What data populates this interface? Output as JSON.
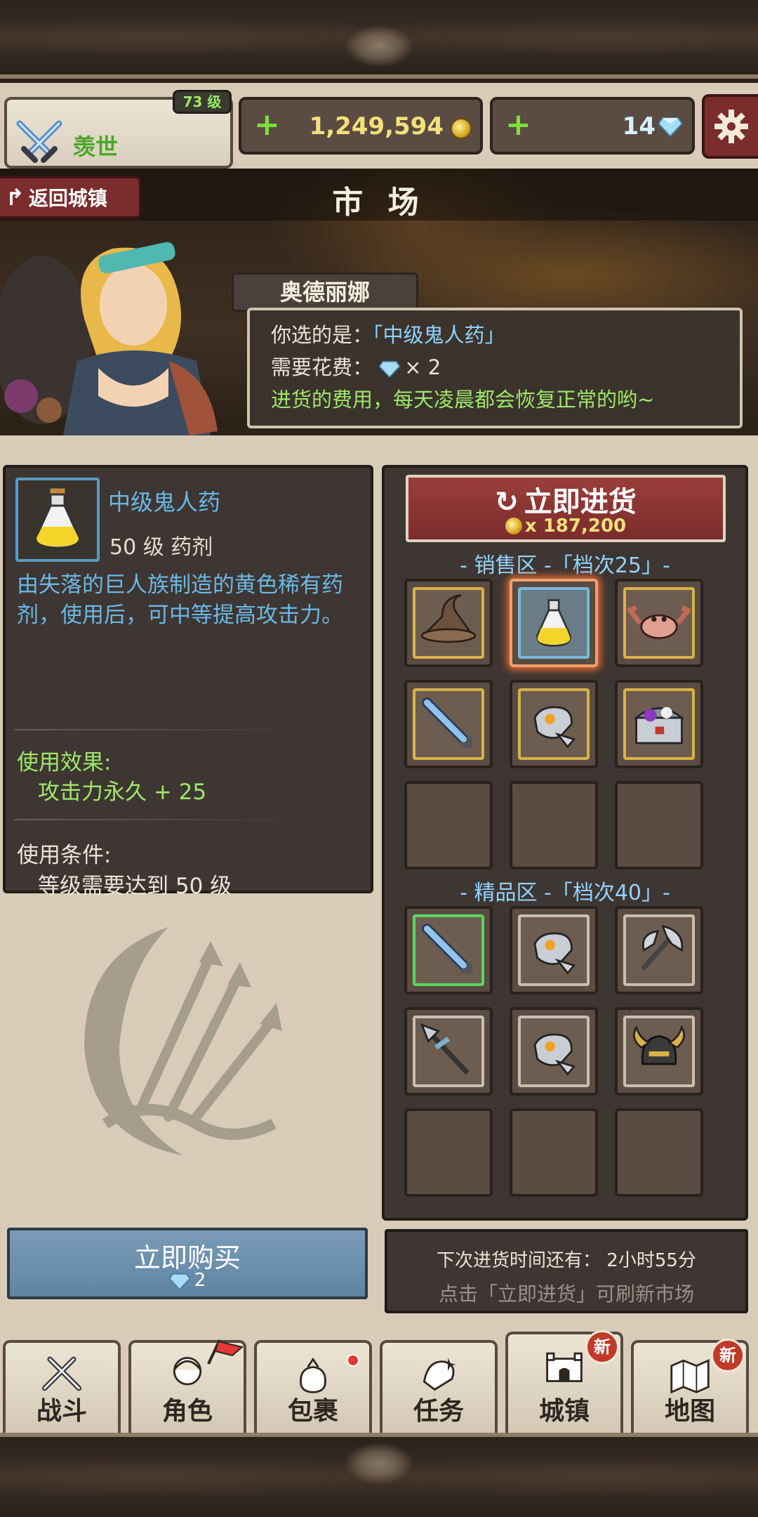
{
  "player": {
    "name": "羡世",
    "level": "73 级"
  },
  "resources": {
    "gold": "1,249,594",
    "gems": "14"
  },
  "colors": {
    "accent_red": "#7b2c2c",
    "gold_text": "#f3e07a",
    "item_blue": "#6ab8e6",
    "effect_green": "#9ee86a"
  },
  "icons": {
    "player": "crossed-swords-icon",
    "add": "plus-icon",
    "gold": "coin-icon",
    "gem": "diamond-icon",
    "settings": "gear-icon",
    "back": "return-arrow-icon",
    "refresh": "refresh-icon"
  },
  "scene": {
    "title": "市 场",
    "back_label": "返回城镇",
    "npc_name": "奥德丽娜",
    "dialog": {
      "selected_label": "你选的是：",
      "selected_item": "「中级鬼人药」",
      "cost_label": "需要花费：",
      "cost_value": "× 2",
      "note": "进货的费用，每天凌晨都会恢复正常的哟~"
    }
  },
  "item": {
    "name": "中级鬼人药",
    "type": "50 级 药剂",
    "description": "由失落的巨人族制造的黄色稀有药剂，使用后，可中等提高攻击力。",
    "effect_title": "使用效果:",
    "effect_value": "攻击力永久 + 25",
    "condition_title": "使用条件:",
    "condition_value": "等级需要达到 50 级"
  },
  "buy": {
    "label": "立即购买",
    "cost": "2"
  },
  "shop": {
    "restock_label": "立即进货",
    "restock_cost": "x 187,200",
    "sale_zone_title": "- 销售区 -「档次25」-",
    "sale_items": [
      {
        "icon": "witch-hat-icon",
        "frame": "gold"
      },
      {
        "icon": "yellow-potion-icon",
        "frame": "blue",
        "selected": true
      },
      {
        "icon": "crab-icon",
        "frame": "gold"
      },
      {
        "icon": "blue-sword-icon",
        "frame": "gold"
      },
      {
        "icon": "gauntlet-icon",
        "frame": "gold"
      },
      {
        "icon": "treasure-chest-icon",
        "frame": "gold"
      },
      {
        "icon": "",
        "frame": "empty"
      },
      {
        "icon": "",
        "frame": "empty"
      },
      {
        "icon": "",
        "frame": "empty"
      }
    ],
    "premium_zone_title": "- 精品区 -「档次40」-",
    "premium_items": [
      {
        "icon": "blue-sword-icon",
        "frame": "green"
      },
      {
        "icon": "gauntlet-icon",
        "frame": "plain"
      },
      {
        "icon": "battle-axe-icon",
        "frame": "plain"
      },
      {
        "icon": "spear-icon",
        "frame": "plain"
      },
      {
        "icon": "gauntlet-icon",
        "frame": "plain"
      },
      {
        "icon": "horned-helmet-icon",
        "frame": "plain"
      },
      {
        "icon": "",
        "frame": "empty"
      },
      {
        "icon": "",
        "frame": "empty"
      },
      {
        "icon": "",
        "frame": "empty"
      }
    ],
    "restock_time": "下次进货时间还有：  2小时55分",
    "restock_hint": "点击「立即进货」可刷新市场"
  },
  "nav": [
    {
      "label": "战斗",
      "icon": "battle-swords-icon"
    },
    {
      "label": "角色",
      "icon": "character-icon",
      "flag": "red-flag-icon"
    },
    {
      "label": "包裹",
      "icon": "bag-icon",
      "dot": true
    },
    {
      "label": "任务",
      "icon": "quest-icon"
    },
    {
      "label": "城镇",
      "icon": "castle-icon",
      "badge": "新",
      "active": true
    },
    {
      "label": "地图",
      "icon": "map-icon",
      "badge": "新"
    }
  ]
}
